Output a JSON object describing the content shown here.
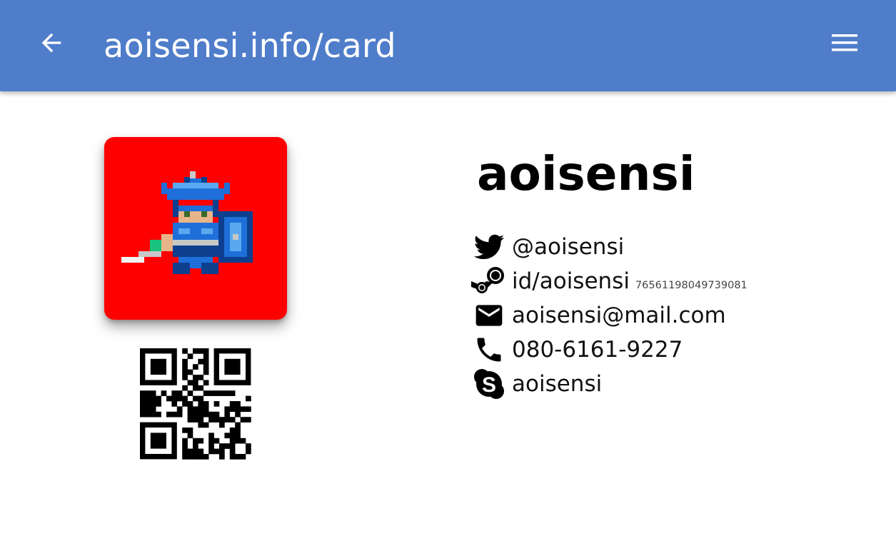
{
  "appbar": {
    "title": "aoisensi.info/card",
    "back_icon": "arrow-back-icon",
    "menu_icon": "hamburger-menu-icon",
    "background_color": "#4f7dca"
  },
  "profile": {
    "name": "aoisensi",
    "avatar_background": "#ff0000",
    "avatar_icon": "pixel-knight-icon",
    "qr_icon": "qr-code-icon"
  },
  "contacts": [
    {
      "icon": "twitter-icon",
      "text": "@aoisensi"
    },
    {
      "icon": "steam-icon",
      "text": "id/aoisensi",
      "sub": "76561198049739081"
    },
    {
      "icon": "email-icon",
      "text": "aoisensi@mail.com"
    },
    {
      "icon": "phone-icon",
      "text": "080-6161-9227"
    },
    {
      "icon": "skype-icon",
      "text": "aoisensi"
    }
  ]
}
